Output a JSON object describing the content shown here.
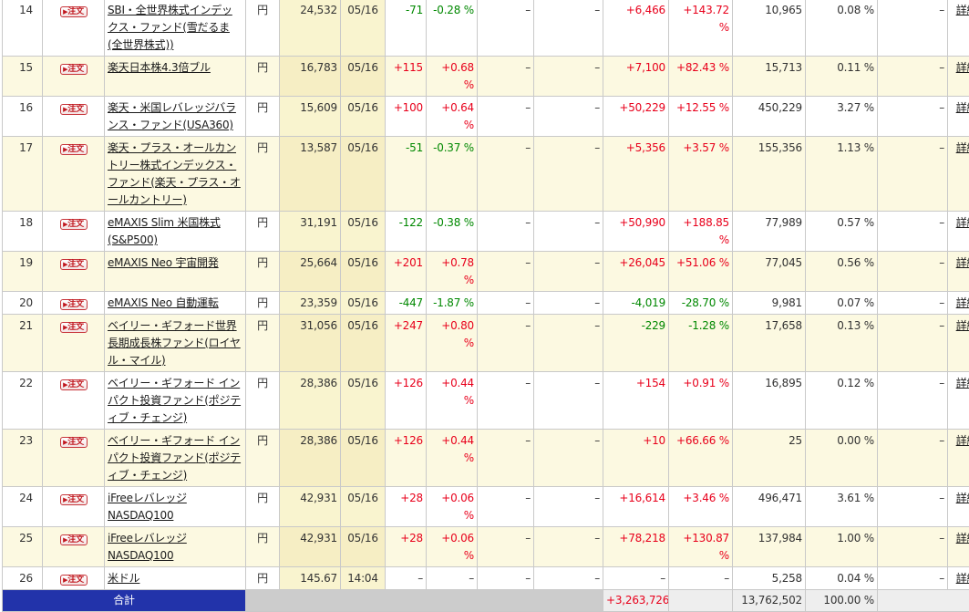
{
  "order_button": {
    "arrow": "▶",
    "label": "注文"
  },
  "detail_label": "詳細",
  "rows": [
    {
      "no": "14",
      "name": "SBI・全世界株式インデックス・ファンド(雪だるま(全世界株式))",
      "currency": "円",
      "price": "24,532",
      "date": "05/16",
      "change": "-71",
      "change_pct": "-0.28 %",
      "col_a": "–",
      "col_b": "–",
      "profit": "+6,466",
      "profit_pct": "+143.72 %",
      "value": "10,965",
      "ratio": "0.08 %",
      "col_c": "–"
    },
    {
      "no": "15",
      "name": "楽天日本株4.3倍ブル",
      "currency": "円",
      "price": "16,783",
      "date": "05/16",
      "change": "+115",
      "change_pct": "+0.68 %",
      "col_a": "–",
      "col_b": "–",
      "profit": "+7,100",
      "profit_pct": "+82.43 %",
      "value": "15,713",
      "ratio": "0.11 %",
      "col_c": "–"
    },
    {
      "no": "16",
      "name": "楽天・米国レバレッジバランス・ファンド(USA360)",
      "currency": "円",
      "price": "15,609",
      "date": "05/16",
      "change": "+100",
      "change_pct": "+0.64 %",
      "col_a": "–",
      "col_b": "–",
      "profit": "+50,229",
      "profit_pct": "+12.55 %",
      "value": "450,229",
      "ratio": "3.27 %",
      "col_c": "–"
    },
    {
      "no": "17",
      "name": "楽天・プラス・オールカントリー株式インデックス・ファンド(楽天・プラス・オールカントリー)",
      "currency": "円",
      "price": "13,587",
      "date": "05/16",
      "change": "-51",
      "change_pct": "-0.37 %",
      "col_a": "–",
      "col_b": "–",
      "profit": "+5,356",
      "profit_pct": "+3.57 %",
      "value": "155,356",
      "ratio": "1.13 %",
      "col_c": "–"
    },
    {
      "no": "18",
      "name": "eMAXIS Slim 米国株式(S&P500)",
      "currency": "円",
      "price": "31,191",
      "date": "05/16",
      "change": "-122",
      "change_pct": "-0.38 %",
      "col_a": "–",
      "col_b": "–",
      "profit": "+50,990",
      "profit_pct": "+188.85 %",
      "value": "77,989",
      "ratio": "0.57 %",
      "col_c": "–"
    },
    {
      "no": "19",
      "name": "eMAXIS Neo 宇宙開発",
      "currency": "円",
      "price": "25,664",
      "date": "05/16",
      "change": "+201",
      "change_pct": "+0.78 %",
      "col_a": "–",
      "col_b": "–",
      "profit": "+26,045",
      "profit_pct": "+51.06 %",
      "value": "77,045",
      "ratio": "0.56 %",
      "col_c": "–"
    },
    {
      "no": "20",
      "name": "eMAXIS Neo 自動運転",
      "currency": "円",
      "price": "23,359",
      "date": "05/16",
      "change": "-447",
      "change_pct": "-1.87 %",
      "col_a": "–",
      "col_b": "–",
      "profit": "-4,019",
      "profit_pct": "-28.70 %",
      "value": "9,981",
      "ratio": "0.07 %",
      "col_c": "–"
    },
    {
      "no": "21",
      "name": "ベイリー・ギフォード世界長期成長株ファンド(ロイヤル・マイル)",
      "currency": "円",
      "price": "31,056",
      "date": "05/16",
      "change": "+247",
      "change_pct": "+0.80 %",
      "col_a": "–",
      "col_b": "–",
      "profit": "-229",
      "profit_pct": "-1.28 %",
      "value": "17,658",
      "ratio": "0.13 %",
      "col_c": "–"
    },
    {
      "no": "22",
      "name": "ベイリー・ギフォード インパクト投資ファンド(ポジティブ・チェンジ)",
      "currency": "円",
      "price": "28,386",
      "date": "05/16",
      "change": "+126",
      "change_pct": "+0.44 %",
      "col_a": "–",
      "col_b": "–",
      "profit": "+154",
      "profit_pct": "+0.91 %",
      "value": "16,895",
      "ratio": "0.12 %",
      "col_c": "–"
    },
    {
      "no": "23",
      "name": "ベイリー・ギフォード インパクト投資ファンド(ポジティブ・チェンジ)",
      "currency": "円",
      "price": "28,386",
      "date": "05/16",
      "change": "+126",
      "change_pct": "+0.44 %",
      "col_a": "–",
      "col_b": "–",
      "profit": "+10",
      "profit_pct": "+66.66 %",
      "value": "25",
      "ratio": "0.00 %",
      "col_c": "–"
    },
    {
      "no": "24",
      "name": "iFreeレバレッジ NASDAQ100",
      "currency": "円",
      "price": "42,931",
      "date": "05/16",
      "change": "+28",
      "change_pct": "+0.06 %",
      "col_a": "–",
      "col_b": "–",
      "profit": "+16,614",
      "profit_pct": "+3.46 %",
      "value": "496,471",
      "ratio": "3.61 %",
      "col_c": "–"
    },
    {
      "no": "25",
      "name": "iFreeレバレッジ NASDAQ100",
      "currency": "円",
      "price": "42,931",
      "date": "05/16",
      "change": "+28",
      "change_pct": "+0.06 %",
      "col_a": "–",
      "col_b": "–",
      "profit": "+78,218",
      "profit_pct": "+130.87 %",
      "value": "137,984",
      "ratio": "1.00 %",
      "col_c": "–"
    },
    {
      "no": "26",
      "name": "米ドル",
      "currency": "円",
      "price": "145.67",
      "date": "14:04",
      "change": "–",
      "change_pct": "–",
      "col_a": "–",
      "col_b": "–",
      "profit": "–",
      "profit_pct": "–",
      "value": "5,258",
      "ratio": "0.04 %",
      "col_c": "–"
    }
  ],
  "total": {
    "label": "合計",
    "profit": "+3,263,726",
    "value": "13,762,502",
    "ratio": "100.00 %"
  },
  "colors": {
    "positive": "#e8001b",
    "negative": "#008800",
    "total_label_bg": "#2233aa"
  }
}
